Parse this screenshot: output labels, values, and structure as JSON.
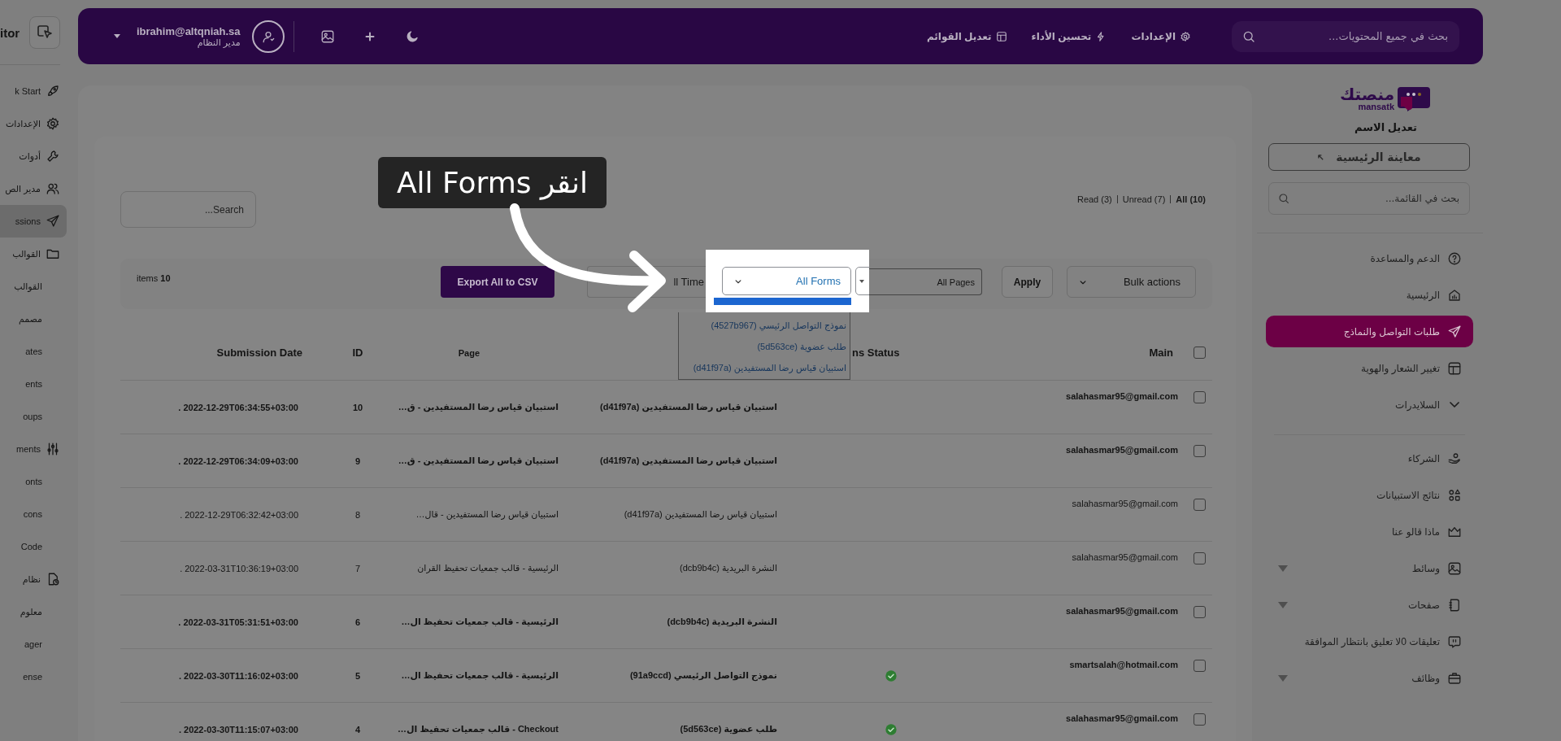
{
  "left_sidebar": {
    "title": "itor",
    "items": [
      {
        "label": "k Start",
        "kind": "main",
        "selected": false
      },
      {
        "label": "الإعدادات",
        "kind": "main",
        "selected": false
      },
      {
        "label": "أدوات",
        "kind": "main",
        "selected": false
      },
      {
        "label": "مدير الص",
        "kind": "main",
        "selected": false
      },
      {
        "label": "ssions",
        "kind": "main",
        "selected": true
      },
      {
        "label": "القوالب",
        "kind": "main",
        "selected": false
      },
      {
        "label": "القوالب",
        "kind": "sub",
        "selected": false
      },
      {
        "label": "مصمم",
        "kind": "sub",
        "selected": false
      },
      {
        "label": "ates",
        "kind": "sub",
        "selected": false
      },
      {
        "label": "ents",
        "kind": "sub",
        "selected": false
      },
      {
        "label": "oups",
        "kind": "sub",
        "selected": false
      },
      {
        "label": "ments",
        "kind": "main",
        "selected": false
      },
      {
        "label": "onts",
        "kind": "sub",
        "selected": false
      },
      {
        "label": "cons",
        "kind": "sub",
        "selected": false
      },
      {
        "label": "Code",
        "kind": "sub",
        "selected": false
      },
      {
        "label": "نظام",
        "kind": "main",
        "selected": false
      },
      {
        "label": "معلوم",
        "kind": "sub",
        "selected": false
      },
      {
        "label": "ager",
        "kind": "sub",
        "selected": false
      },
      {
        "label": "ense",
        "kind": "sub",
        "selected": false
      }
    ]
  },
  "top_bar": {
    "user": {
      "email": "ibrahim@altqniah.sa",
      "role": "مدير النظام"
    },
    "links": [
      "الإعدادات",
      "تحسين الأداء",
      "تعديل القوائم"
    ],
    "search": {
      "placeholder": "بحث في جميع المحتويات..."
    }
  },
  "content": {
    "search": {
      "placeholder": "Search..."
    },
    "views": [
      {
        "label": "All",
        "count": "(10)",
        "selected": true
      },
      {
        "label": "Unread",
        "count": "(7)",
        "selected": false
      },
      {
        "label": "Read",
        "count": "(3)",
        "selected": false
      }
    ],
    "items_count": "items **10**",
    "export_button": "Export All to CSV",
    "date_filter": "ll Time",
    "form_filter": "All Forms",
    "page_filter": "All Pages",
    "apply_button": "Apply",
    "bulk_actions": "Bulk actions",
    "form_options": [
      "نموذج التواصل الرئيسي (4527b967)",
      "طلب عضوية (5d563ce)",
      "استبيان قياس رضا المستفيدين (d41f97a)"
    ],
    "table": {
      "columns": {
        "date": "Submission Date",
        "id": "ID",
        "page": "Page",
        "status": "ns Status",
        "main": "Main"
      },
      "all_checked": false,
      "rows": [
        {
          "date": ". 2022-12-29T06:34:55+03:00",
          "id": "10",
          "page": "استبيان قياس رضا المستفيدين - ق…",
          "form": "استبيان قياس رضا المستفيدين (d41f97a)",
          "email": "salahasmar95@gmail.com",
          "read": false,
          "approved": false,
          "checked": false
        },
        {
          "date": ". 2022-12-29T06:34:09+03:00",
          "id": "9",
          "page": "استبيان قياس رضا المستفيدين - ق…",
          "form": "استبيان قياس رضا المستفيدين (d41f97a)",
          "email": "salahasmar95@gmail.com",
          "read": false,
          "approved": false,
          "checked": false
        },
        {
          "date": ". 2022-12-29T06:32:42+03:00",
          "id": "8",
          "page": "استبيان قياس رضا المستفيدين - قال…",
          "form": "استبيان قياس رضا المستفيدين (d41f97a)",
          "email": "salahasmar95@gmail.com",
          "read": true,
          "approved": false,
          "checked": false
        },
        {
          "date": ". 2022-03-31T10:36:19+03:00",
          "id": "7",
          "page": "الرئيسية - قالب جمعيات تحفيظ القران",
          "form": "النشرة البريدية (dcb9b4c)",
          "email": "salahasmar95@gmail.com",
          "read": true,
          "approved": false,
          "checked": false
        },
        {
          "date": ". 2022-03-31T05:31:51+03:00",
          "id": "6",
          "page": "الرئيسية - قالب جمعيات تحفيظ ال…",
          "form": "النشرة البريدية (dcb9b4c)",
          "email": "salahasmar95@gmail.com",
          "read": false,
          "approved": false,
          "checked": false
        },
        {
          "date": ". 2022-03-30T11:16:02+03:00",
          "id": "5",
          "page": "الرئيسية - قالب جمعيات تحفيظ ال…",
          "form": "نموذج التواصل الرئيسي (91a9ccd)",
          "email": "smartsalah@hotmail.com",
          "read": false,
          "approved": true,
          "checked": false
        },
        {
          "date": ". 2022-03-30T11:15:07+03:00",
          "id": "4",
          "page": "Checkout - قالب جمعيات تحفيظ ال…",
          "form": "طلب عضوية (5d563ce)",
          "email": "salahasmar95@gmail.com",
          "read": false,
          "approved": true,
          "checked": false
        }
      ]
    }
  },
  "right_sidebar": {
    "logo": {
      "name": "منصتك",
      "sub": "mansatk"
    },
    "site_name": "تعديل الاسم",
    "preview_button": "معاينة الرئيسية",
    "search": {
      "placeholder": "بحث في القائمة..."
    },
    "menu_top": [
      {
        "label": "الدعم والمساعدة",
        "selected": false,
        "has_submenu": false
      },
      {
        "label": "الرئيسية",
        "selected": false,
        "has_submenu": false
      },
      {
        "label": "طلبات التواصل والنماذج",
        "selected": true,
        "has_submenu": false
      },
      {
        "label": "تغيير الشعار والهوية",
        "selected": false,
        "has_submenu": false
      },
      {
        "label": "السلايدرات",
        "selected": false,
        "has_submenu": false
      }
    ],
    "menu_bottom": [
      {
        "label": "الشركاء",
        "selected": false,
        "has_submenu": false
      },
      {
        "label": "نتائج الاستبيانات",
        "selected": false,
        "has_submenu": false
      },
      {
        "label": "ماذا قالو عنا",
        "selected": false,
        "has_submenu": false
      },
      {
        "label": "وسائط",
        "selected": false,
        "has_submenu": true
      },
      {
        "label": "صفحات",
        "selected": false,
        "has_submenu": true
      },
      {
        "label": "تعليقات 0لا تعليق بانتظار الموافقة",
        "selected": false,
        "has_submenu": false
      },
      {
        "label": "وظائف",
        "selected": false,
        "has_submenu": true
      }
    ]
  },
  "callout": {
    "text": "انقر All Forms"
  }
}
